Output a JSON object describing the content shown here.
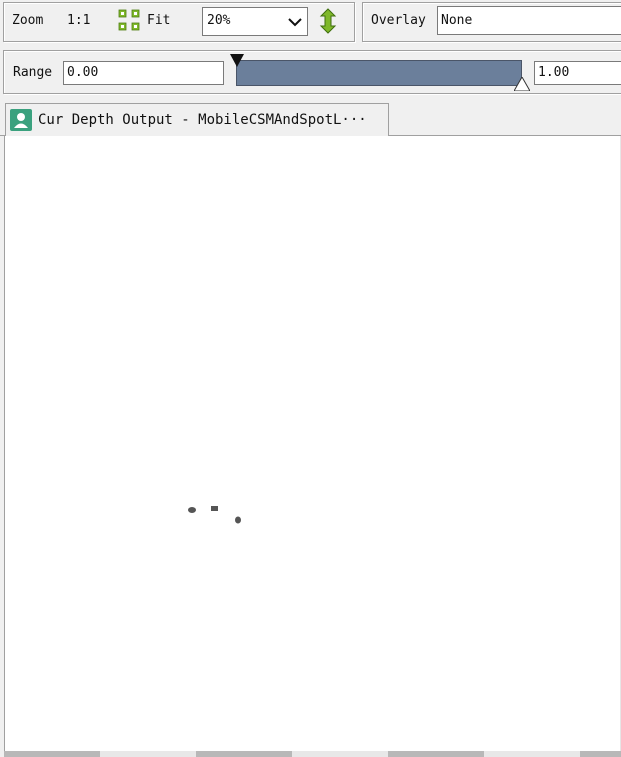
{
  "toolbar": {
    "zoom_label": "Zoom",
    "ratio_label": "1:1",
    "fit_label": "Fit",
    "zoom_value": "20%",
    "overlay_label": "Overlay",
    "overlay_value": "None"
  },
  "range": {
    "label": "Range",
    "min_value": "0.00",
    "max_value": "1.00",
    "slider_low": 0.0,
    "slider_high": 1.0
  },
  "tab": {
    "title": "Cur Depth Output - MobileCSMAndSpotL···"
  },
  "colors": {
    "accent_green": "#7fb82a",
    "slider_fill": "#6b7f9b",
    "tab_icon": "#3aa17e",
    "canvas": "#ffffff"
  },
  "icons": {
    "fit": "fit-icon",
    "zoom_dropdown": "chevron-down-icon",
    "flip": "vertical-arrows-icon",
    "tab": "texture-viewer-icon"
  }
}
